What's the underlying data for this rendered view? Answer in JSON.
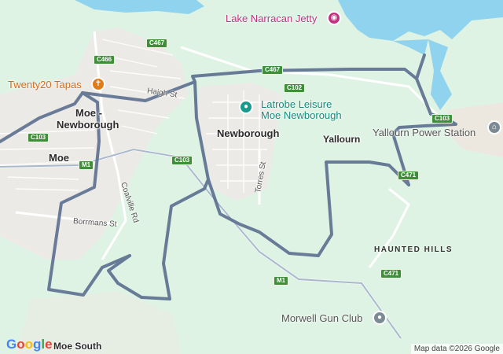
{
  "map": {
    "places": {
      "lake": "Lake Narracan Jetty",
      "tapas": "Twenty20 Tapas",
      "moe_newborough_1": "Moe -",
      "moe_newborough_2": "Newborough",
      "moe": "Moe",
      "newborough": "Newborough",
      "yallourn": "Yallourn",
      "latrobe_1": "Latrobe Leisure",
      "latrobe_2": "Moe Newborough",
      "power_station": "Yallourn Power Station",
      "haunted_hills": "HAUNTED HILLS",
      "gun_club": "Morwell Gun Club",
      "moe_south": "Moe South"
    },
    "streets": {
      "haigh": "Haigh St",
      "torres": "Torres St",
      "coalville": "Coalville Rd",
      "borrmans": "Borrmans St"
    },
    "shields": {
      "c467_a": "C467",
      "c467_b": "C467",
      "c466": "C466",
      "c102": "C102",
      "c103_a": "C103",
      "c103_b": "C103",
      "c103_c": "C103",
      "m1_a": "M1",
      "m1_b": "M1",
      "c471_a": "C471",
      "c471_b": "C471"
    },
    "attribution": "Map data ©2026 Google",
    "logo": [
      "G",
      "o",
      "o",
      "g",
      "l",
      "e"
    ],
    "route_color": "#5b6f8f"
  }
}
